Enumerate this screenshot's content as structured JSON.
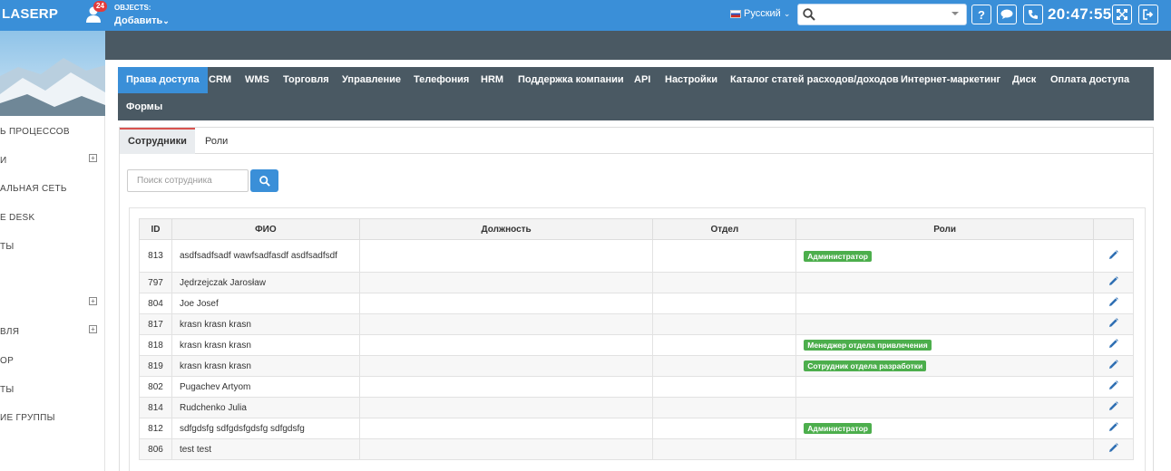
{
  "app": {
    "logo": "LASERP",
    "notifications": "24",
    "objects_label": "OBJECTS:",
    "objects_add": "Добавить",
    "language": "Русский",
    "clock": "20:47:55",
    "help_label": "?"
  },
  "sidebar": {
    "items": [
      {
        "label": "Ь ПРОЦЕССОВ",
        "expandable": false
      },
      {
        "label": "И",
        "expandable": true
      },
      {
        "label": "АЛЬНАЯ СЕТЬ",
        "expandable": false
      },
      {
        "label": "E DESK",
        "expandable": false
      },
      {
        "label": "ТЫ",
        "expandable": false
      },
      {
        "label": "",
        "expandable": true
      },
      {
        "label": "ВЛЯ",
        "expandable": true
      },
      {
        "label": "ОР",
        "expandable": false
      },
      {
        "label": "ТЫ",
        "expandable": false
      },
      {
        "label": "ИЕ ГРУППЫ",
        "expandable": false
      }
    ]
  },
  "module_tabs": [
    "Права доступа",
    "CRM",
    "WMS",
    "Торговля",
    "Управление",
    "Телефония",
    "HRM",
    "Поддержка компании",
    "API",
    "Настройки",
    "Каталог статей расходов/доходов",
    "Интернет-маркетинг",
    "Диск",
    "Оплата доступа",
    "Формы"
  ],
  "sub_tabs": [
    "Сотрудники",
    "Роли"
  ],
  "employee_search": {
    "placeholder": "Поиск сотрудника"
  },
  "table": {
    "headers": [
      "ID",
      "ФИО",
      "Должность",
      "Отдел",
      "Роли",
      ""
    ],
    "rows": [
      {
        "id": "813",
        "name": "asdfsadfsadf wawfsadfasdf asdfsadfsdf",
        "position": "",
        "department": "",
        "role": "Администратор"
      },
      {
        "id": "797",
        "name": "Jędrzejczak Jarosław",
        "position": "",
        "department": "",
        "role": ""
      },
      {
        "id": "804",
        "name": "Joe Josef",
        "position": "",
        "department": "",
        "role": ""
      },
      {
        "id": "817",
        "name": "krasn krasn krasn",
        "position": "",
        "department": "",
        "role": ""
      },
      {
        "id": "818",
        "name": "krasn krasn krasn",
        "position": "",
        "department": "",
        "role": "Менеджер отдела привлечения"
      },
      {
        "id": "819",
        "name": "krasn krasn krasn",
        "position": "",
        "department": "",
        "role": "Сотрудник отдела разработки"
      },
      {
        "id": "802",
        "name": "Pugachev Artyom",
        "position": "",
        "department": "",
        "role": ""
      },
      {
        "id": "814",
        "name": "Rudchenko Julia",
        "position": "",
        "department": "",
        "role": ""
      },
      {
        "id": "812",
        "name": "sdfgdsfg sdfgdsfgdsfg sdfgdsfg",
        "position": "",
        "department": "",
        "role": "Администратор"
      },
      {
        "id": "806",
        "name": "test test",
        "position": "",
        "department": "",
        "role": ""
      }
    ]
  },
  "colors": {
    "accent": "#3a8fd8",
    "header_dark": "#4a5963",
    "badge_green": "#4cae4c"
  }
}
